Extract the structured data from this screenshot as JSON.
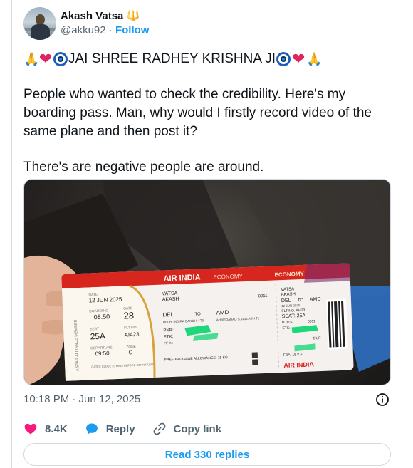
{
  "author": {
    "display_name": "Akash Vatsa 🔱",
    "handle": "@akku92",
    "separator": "·",
    "follow_label": "Follow"
  },
  "tweet": {
    "title_text": "JAI SHREE RADHEY KRISHNA JI",
    "paragraph_1": "People who wanted to check the credibility. Here's my boarding pass. Man, why would I firstly record video of the same plane and then post it?",
    "paragraph_2": "There's are negative people are around."
  },
  "boarding_pass": {
    "airline": "AIR INDIA",
    "class": "ECONOMY",
    "alliance": "A STAR ALLIANCE MEMBER",
    "date_label": "DATE",
    "date": "12 JUN 2025",
    "boarding_label": "BOARDING",
    "boarding_time": "08:50",
    "gate_label": "GATE",
    "gate": "28",
    "seat_label": "SEAT",
    "seat": "25A",
    "flt_label": "FLT NO.",
    "flight": "AI423",
    "departure_label": "DEPARTURE",
    "departure_time": "09:50",
    "zone_label": "ZONE",
    "zone": "C",
    "gate_note": "GATES CLOSE 20 MINS BEFORE DEPARTURE",
    "passenger_last": "VATSA",
    "passenger_first": "AKASH",
    "seq": "0011",
    "from": "DEL",
    "to_label": "TO",
    "to": "AMD",
    "from_full": "DELHI INDIRA GANDHI I T3",
    "to_full": "AHMEDABAD S.VALLABH T1",
    "pnr_label": "PNR:",
    "etk_label": "ETK:",
    "ff_label": "FF AI:",
    "baggage": "FREE BAGGAGE ALLOWANCE: 15 KG",
    "stub_last": "VATSA",
    "stub_first": "AKASH",
    "stub_from": "DEL",
    "stub_to_label": "TO",
    "stub_to": "AMD",
    "stub_date": "12 JUN 2025",
    "stub_flt": "FLT NO. AI423",
    "stub_seat": "SEAT: 25A",
    "stub_pcs": "0 pcs",
    "stub_seq": "0011",
    "stub_etk": "ETK:",
    "stub_dup": "DUP",
    "stub_fba": "FBA: 15 KG"
  },
  "meta": {
    "timestamp": "10:18 PM · Jun 12, 2025"
  },
  "actions": {
    "likes": "8.4K",
    "reply_label": "Reply",
    "copy_label": "Copy link",
    "read_replies": "Read 330 replies"
  },
  "colors": {
    "brand_blue": "#1d9bf0",
    "like_pink": "#f91880",
    "air_india_red": "#d7261e"
  }
}
